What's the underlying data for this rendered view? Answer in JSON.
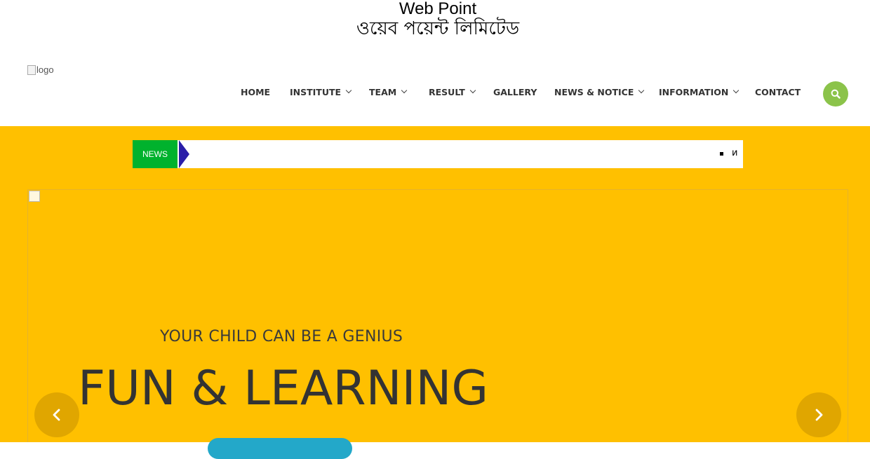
{
  "header": {
    "title_en": "Web Point",
    "title_bn": "ওয়েব পয়েন্ট লিমিটেড",
    "logo_alt": "logo"
  },
  "nav": {
    "items": [
      {
        "label": "HOME",
        "has_dropdown": false
      },
      {
        "label": "INSTITUTE",
        "has_dropdown": true
      },
      {
        "label": "TEAM",
        "has_dropdown": true
      },
      {
        "label": "RESULT",
        "has_dropdown": true
      },
      {
        "label": "GALLERY",
        "has_dropdown": false
      },
      {
        "label": "NEWS & NOTICE",
        "has_dropdown": true
      },
      {
        "label": "INFORMATION",
        "has_dropdown": true
      },
      {
        "label": "CONTACT",
        "has_dropdown": false
      }
    ],
    "search_icon": "search-icon"
  },
  "ticker": {
    "label": "NEWS",
    "text": "и"
  },
  "hero": {
    "subheading": "YOUR CHILD CAN BE A GENIUS",
    "headline": "FUN & LEARNING",
    "prev_icon": "chevron-left-icon",
    "next_icon": "chevron-right-icon"
  },
  "colors": {
    "hero_bg": "#ffc000",
    "news_label_bg": "#00b22d",
    "ticker_arrow": "#2a1ea8",
    "search_btn": "#8bc34a",
    "slider_arrow": "#e0a600",
    "cta": "#23a8c9"
  }
}
